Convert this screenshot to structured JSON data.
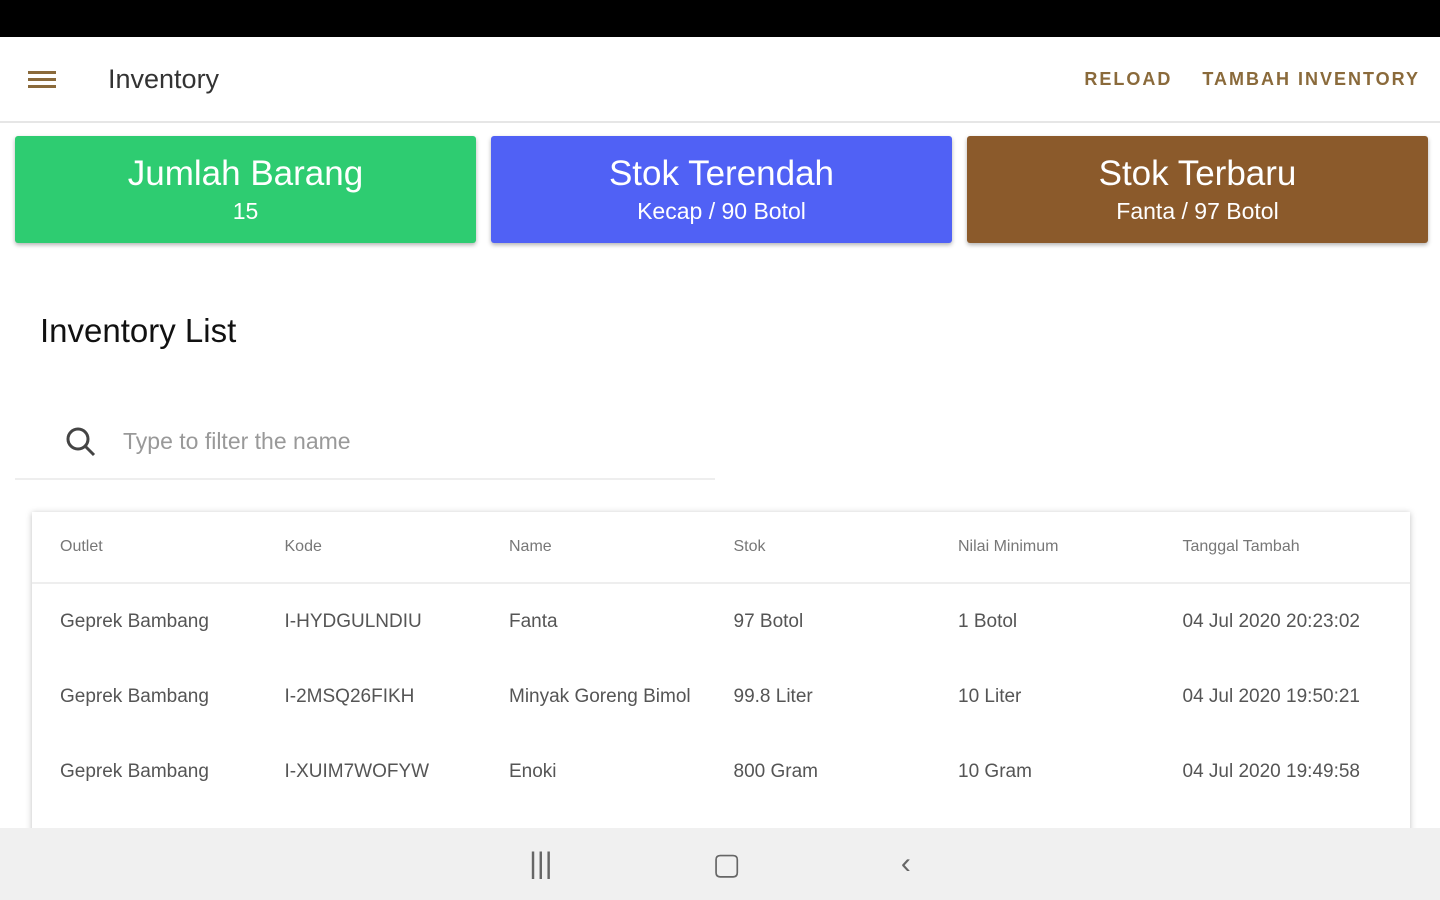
{
  "appbar": {
    "title": "Inventory",
    "reload": "RELOAD",
    "add": "TAMBAH INVENTORY"
  },
  "cards": [
    {
      "title": "Jumlah Barang",
      "value": "15",
      "color": "#2ecc71"
    },
    {
      "title": "Stok Terendah",
      "value": "Kecap / 90 Botol",
      "color": "#5061f5"
    },
    {
      "title": "Stok Terbaru",
      "value": "Fanta / 97 Botol",
      "color": "#8b5a2b"
    }
  ],
  "section_title": "Inventory List",
  "search": {
    "placeholder": "Type to filter the name"
  },
  "table": {
    "headers": [
      "Outlet",
      "Kode",
      "Name",
      "Stok",
      "Nilai Minimum",
      "Tanggal Tambah"
    ],
    "rows": [
      [
        "Geprek Bambang",
        "I-HYDGULNDIU",
        "Fanta",
        "97 Botol",
        "1 Botol",
        "04 Jul 2020 20:23:02"
      ],
      [
        "Geprek Bambang",
        "I-2MSQ26FIKH",
        "Minyak Goreng Bimol",
        "99.8 Liter",
        "10 Liter",
        "04 Jul 2020 19:50:21"
      ],
      [
        "Geprek Bambang",
        "I-XUIM7WOFYW",
        "Enoki",
        "800 Gram",
        "10 Gram",
        "04 Jul 2020 19:49:58"
      ]
    ]
  },
  "navbar": {
    "recents": "|||",
    "home": "▢",
    "back": "‹"
  }
}
